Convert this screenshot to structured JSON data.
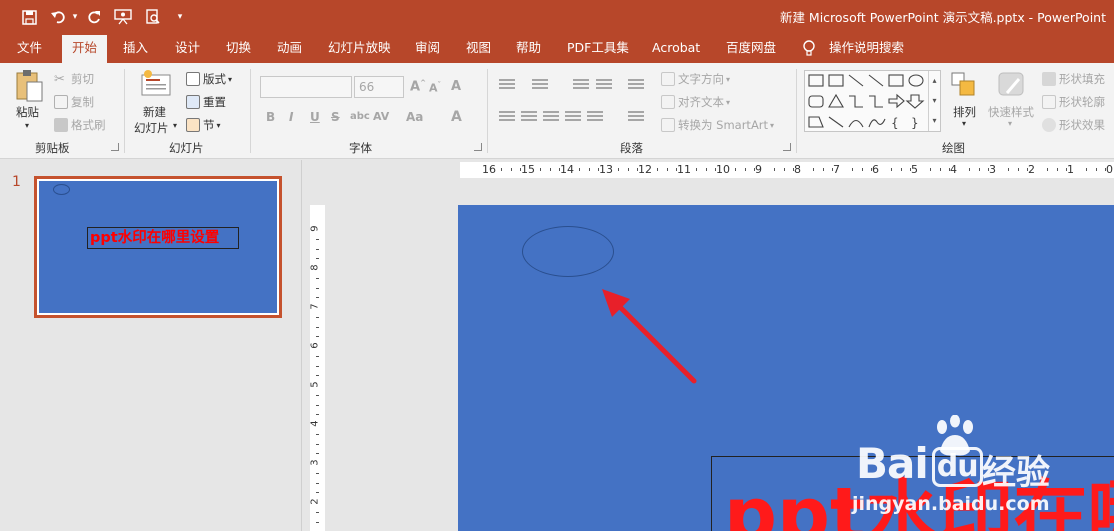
{
  "window": {
    "title": "新建 Microsoft PowerPoint 演示文稿.pptx  -  PowerPoint"
  },
  "tabs": [
    {
      "label": "文件"
    },
    {
      "label": "开始"
    },
    {
      "label": "插入"
    },
    {
      "label": "设计"
    },
    {
      "label": "切换"
    },
    {
      "label": "动画"
    },
    {
      "label": "幻灯片放映"
    },
    {
      "label": "审阅"
    },
    {
      "label": "视图"
    },
    {
      "label": "帮助"
    },
    {
      "label": "PDF工具集"
    },
    {
      "label": "Acrobat"
    },
    {
      "label": "百度网盘"
    },
    {
      "label": "操作说明搜索"
    }
  ],
  "clipboard": {
    "paste": "粘贴",
    "cut": "剪切",
    "copy": "复制",
    "format_painter": "格式刷",
    "label": "剪贴板"
  },
  "slides_group": {
    "new_slide_1": "新建",
    "new_slide_2": "幻灯片",
    "layout": "版式",
    "reset": "重置",
    "section": "节",
    "label": "幻灯片"
  },
  "font_group": {
    "font_size": "66",
    "bold": "B",
    "italic": "I",
    "underline": "U",
    "strike": "S",
    "shadow": "abc",
    "spacing": "AV",
    "case": "Aa",
    "color": "A",
    "label": "字体"
  },
  "paragraph_group": {
    "text_direction": "文字方向",
    "align_text": "对齐文本",
    "smartart": "转换为 SmartArt",
    "label": "段落"
  },
  "drawing_group": {
    "arrange": "排列",
    "quick_styles": "快速样式",
    "shape_fill": "形状填充",
    "shape_outline": "形状轮廓",
    "shape_effects": "形状效果",
    "label": "绘图"
  },
  "thumbnail": {
    "number": "1",
    "text": "ppt水印在哪里设置"
  },
  "hruler": [
    "16",
    "15",
    "14",
    "13",
    "12",
    "11",
    "10",
    "9",
    "8",
    "7",
    "6",
    "5",
    "4",
    "3",
    "2",
    "1",
    "0",
    "1"
  ],
  "vruler": [
    "9",
    "8",
    "7",
    "6",
    "5",
    "4",
    "3",
    "2"
  ],
  "slide": {
    "text": "ppt水印在哪里设置"
  },
  "watermark": {
    "logo": "Bai",
    "logo2": "du",
    "cn": "经验",
    "url": "jingyan.baidu.com"
  },
  "colors": {
    "brand": "#b7472a",
    "slide_bg": "#4472c4",
    "slide_text": "#ff1a1a",
    "arrow": "#e8202a"
  }
}
